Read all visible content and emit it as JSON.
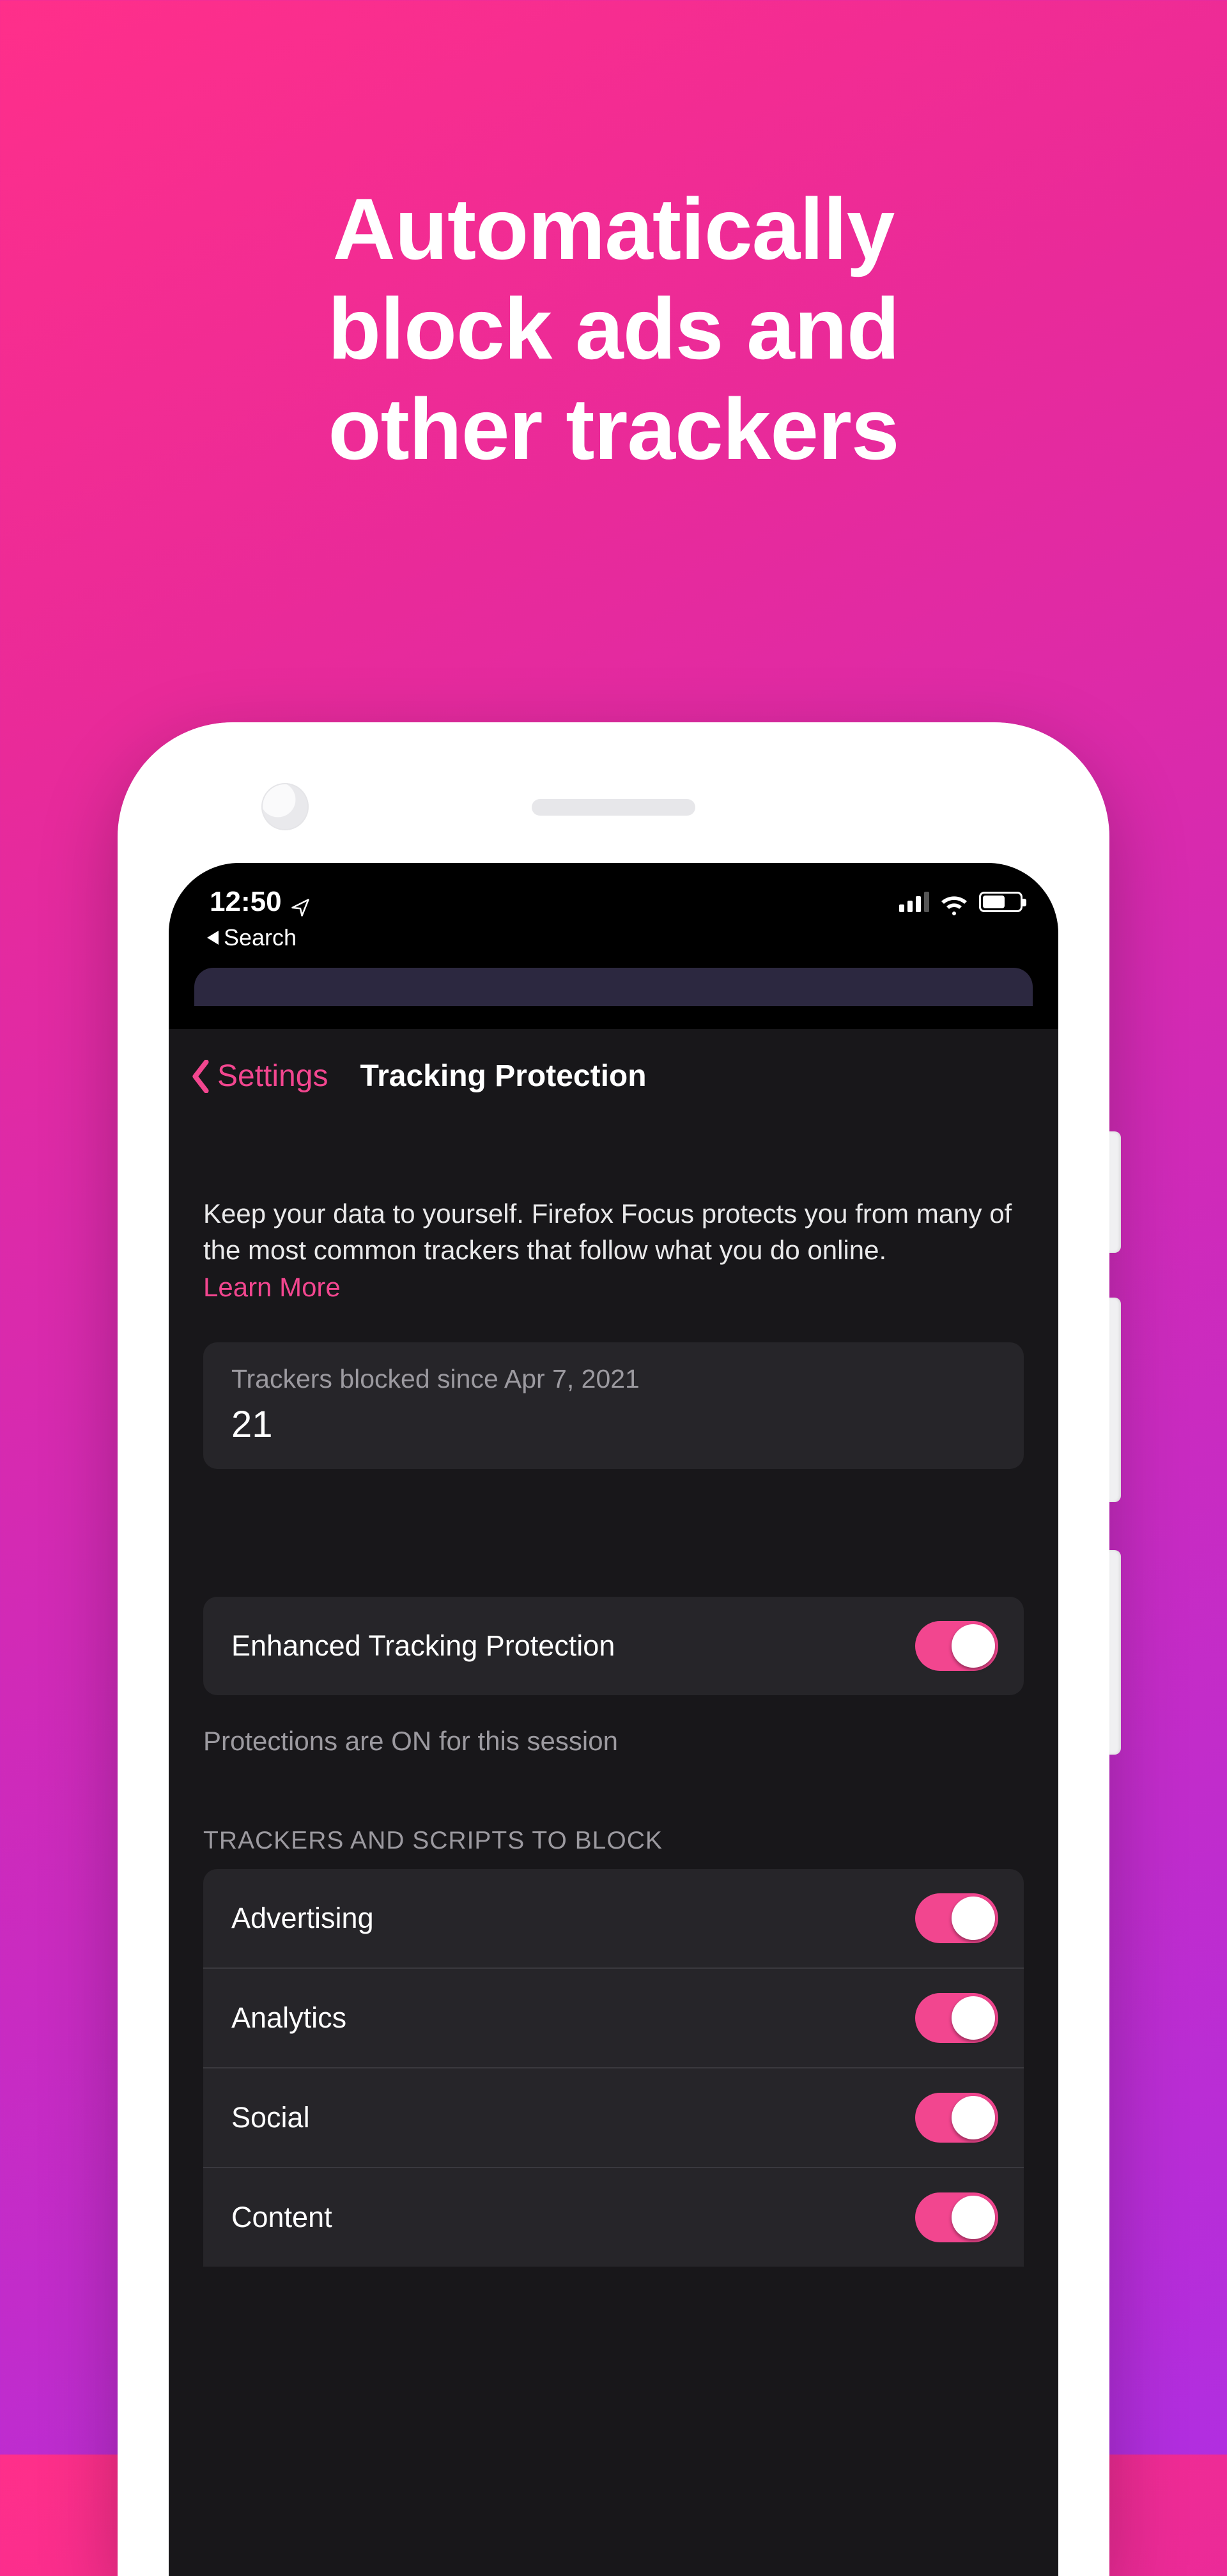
{
  "marketing": {
    "headline_l1": "Automatically",
    "headline_l2": "block ads and",
    "headline_l3": "other trackers"
  },
  "status": {
    "time": "12:50",
    "back_app": "Search"
  },
  "nav": {
    "back_label": "Settings",
    "title": "Tracking Protection"
  },
  "intro": {
    "text": "Keep your data to yourself. Firefox Focus protects you from many of the most common trackers that follow what you do online.",
    "learn_more": "Learn More"
  },
  "stats": {
    "label": "Trackers blocked since Apr 7, 2021",
    "count": "21"
  },
  "etp": {
    "label": "Enhanced Tracking Protection",
    "on": true,
    "note": "Protections are ON for this session"
  },
  "block": {
    "header": "TRACKERS AND SCRIPTS TO BLOCK",
    "items": [
      {
        "label": "Advertising",
        "on": true
      },
      {
        "label": "Analytics",
        "on": true
      },
      {
        "label": "Social",
        "on": true
      },
      {
        "label": "Content",
        "on": true
      }
    ]
  },
  "colors": {
    "accent": "#f2468f"
  }
}
